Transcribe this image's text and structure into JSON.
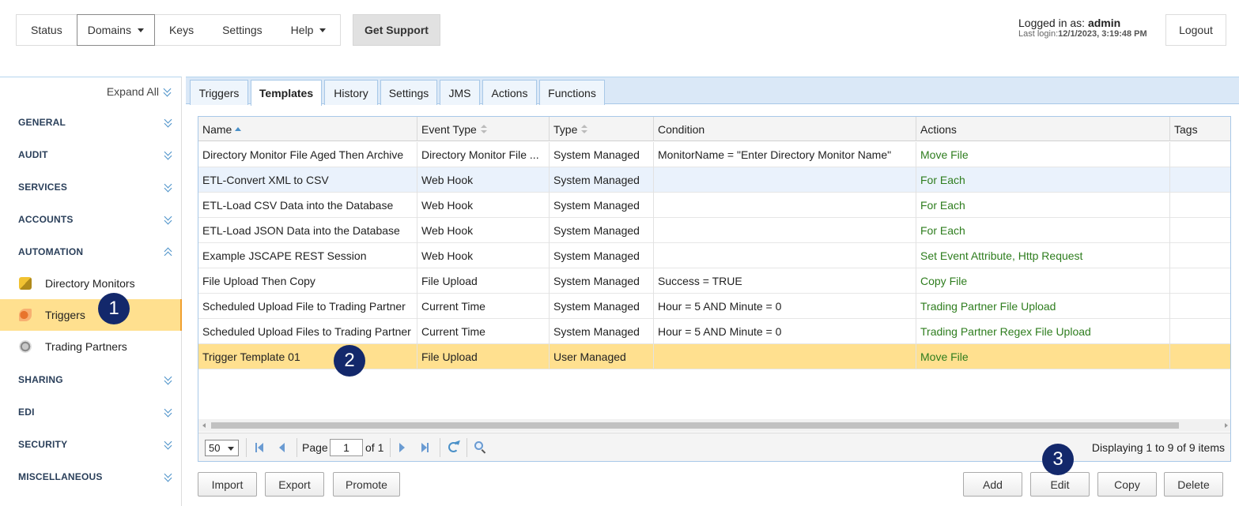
{
  "topnav": {
    "items": [
      {
        "label": "Status"
      },
      {
        "label": "Domains"
      },
      {
        "label": "Keys"
      },
      {
        "label": "Settings"
      },
      {
        "label": "Help"
      }
    ],
    "get_support": "Get Support"
  },
  "login": {
    "prefix": "Logged in as: ",
    "user": "admin",
    "last_login_prefix": "Last login:",
    "last_login": "12/1/2023, 3:19:48 PM",
    "logout": "Logout"
  },
  "sidebar": {
    "expand_all": "Expand All",
    "sections": [
      {
        "label": "GENERAL"
      },
      {
        "label": "AUDIT"
      },
      {
        "label": "SERVICES"
      },
      {
        "label": "ACCOUNTS"
      },
      {
        "label": "AUTOMATION"
      },
      {
        "label": "SHARING"
      },
      {
        "label": "EDI"
      },
      {
        "label": "SECURITY"
      },
      {
        "label": "MISCELLANEOUS"
      }
    ],
    "automation_items": [
      {
        "label": "Directory Monitors",
        "icon": "directory-monitor-icon"
      },
      {
        "label": "Triggers",
        "icon": "trigger-icon"
      },
      {
        "label": "Trading Partners",
        "icon": "trading-partner-icon"
      }
    ]
  },
  "tabs": [
    {
      "label": "Triggers"
    },
    {
      "label": "Templates"
    },
    {
      "label": "History"
    },
    {
      "label": "Settings"
    },
    {
      "label": "JMS"
    },
    {
      "label": "Actions"
    },
    {
      "label": "Functions"
    }
  ],
  "grid": {
    "columns": [
      "Name",
      "Event Type",
      "Type",
      "Condition",
      "Actions",
      "Tags"
    ],
    "rows": [
      {
        "name": "Directory Monitor File Aged Then Archive",
        "event_type": "Directory Monitor File ...",
        "type": "System Managed",
        "condition": "MonitorName = \"Enter Directory Monitor Name\"",
        "actions": "Move File",
        "tags": ""
      },
      {
        "name": "ETL-Convert XML to CSV",
        "event_type": "Web Hook",
        "type": "System Managed",
        "condition": "",
        "actions": "For Each",
        "tags": ""
      },
      {
        "name": "ETL-Load CSV Data into the Database",
        "event_type": "Web Hook",
        "type": "System Managed",
        "condition": "",
        "actions": "For Each",
        "tags": ""
      },
      {
        "name": "ETL-Load JSON Data into the Database",
        "event_type": "Web Hook",
        "type": "System Managed",
        "condition": "",
        "actions": "For Each",
        "tags": ""
      },
      {
        "name": "Example JSCAPE REST Session",
        "event_type": "Web Hook",
        "type": "System Managed",
        "condition": "",
        "actions": "Set Event Attribute, Http Request",
        "tags": ""
      },
      {
        "name": "File Upload Then Copy",
        "event_type": "File Upload",
        "type": "System Managed",
        "condition": "Success = TRUE",
        "actions": "Copy File",
        "tags": ""
      },
      {
        "name": "Scheduled Upload File to Trading Partner",
        "event_type": "Current Time",
        "type": "System Managed",
        "condition": "Hour = 5 AND Minute = 0",
        "actions": "Trading Partner File Upload",
        "tags": ""
      },
      {
        "name": "Scheduled Upload Files to Trading Partner",
        "event_type": "Current Time",
        "type": "System Managed",
        "condition": "Hour = 5 AND Minute = 0",
        "actions": "Trading Partner Regex File Upload",
        "tags": ""
      },
      {
        "name": "Trigger Template 01",
        "event_type": "File Upload",
        "type": "User Managed",
        "condition": "",
        "actions": "Move File",
        "tags": ""
      }
    ]
  },
  "pager": {
    "page_size": "50",
    "page_label": "Page",
    "page_value": "1",
    "of_label": "of 1",
    "displaying": "Displaying 1 to 9 of 9 items"
  },
  "buttons": {
    "import": "Import",
    "export": "Export",
    "promote": "Promote",
    "add": "Add",
    "edit": "Edit",
    "copy": "Copy",
    "delete": "Delete"
  },
  "callouts": [
    "1",
    "2",
    "3"
  ],
  "colors": {
    "selected_row": "#ffe08f",
    "action_text": "#2e7d1e",
    "callout": "#13286b",
    "tab_bar": "#dae8f7"
  }
}
